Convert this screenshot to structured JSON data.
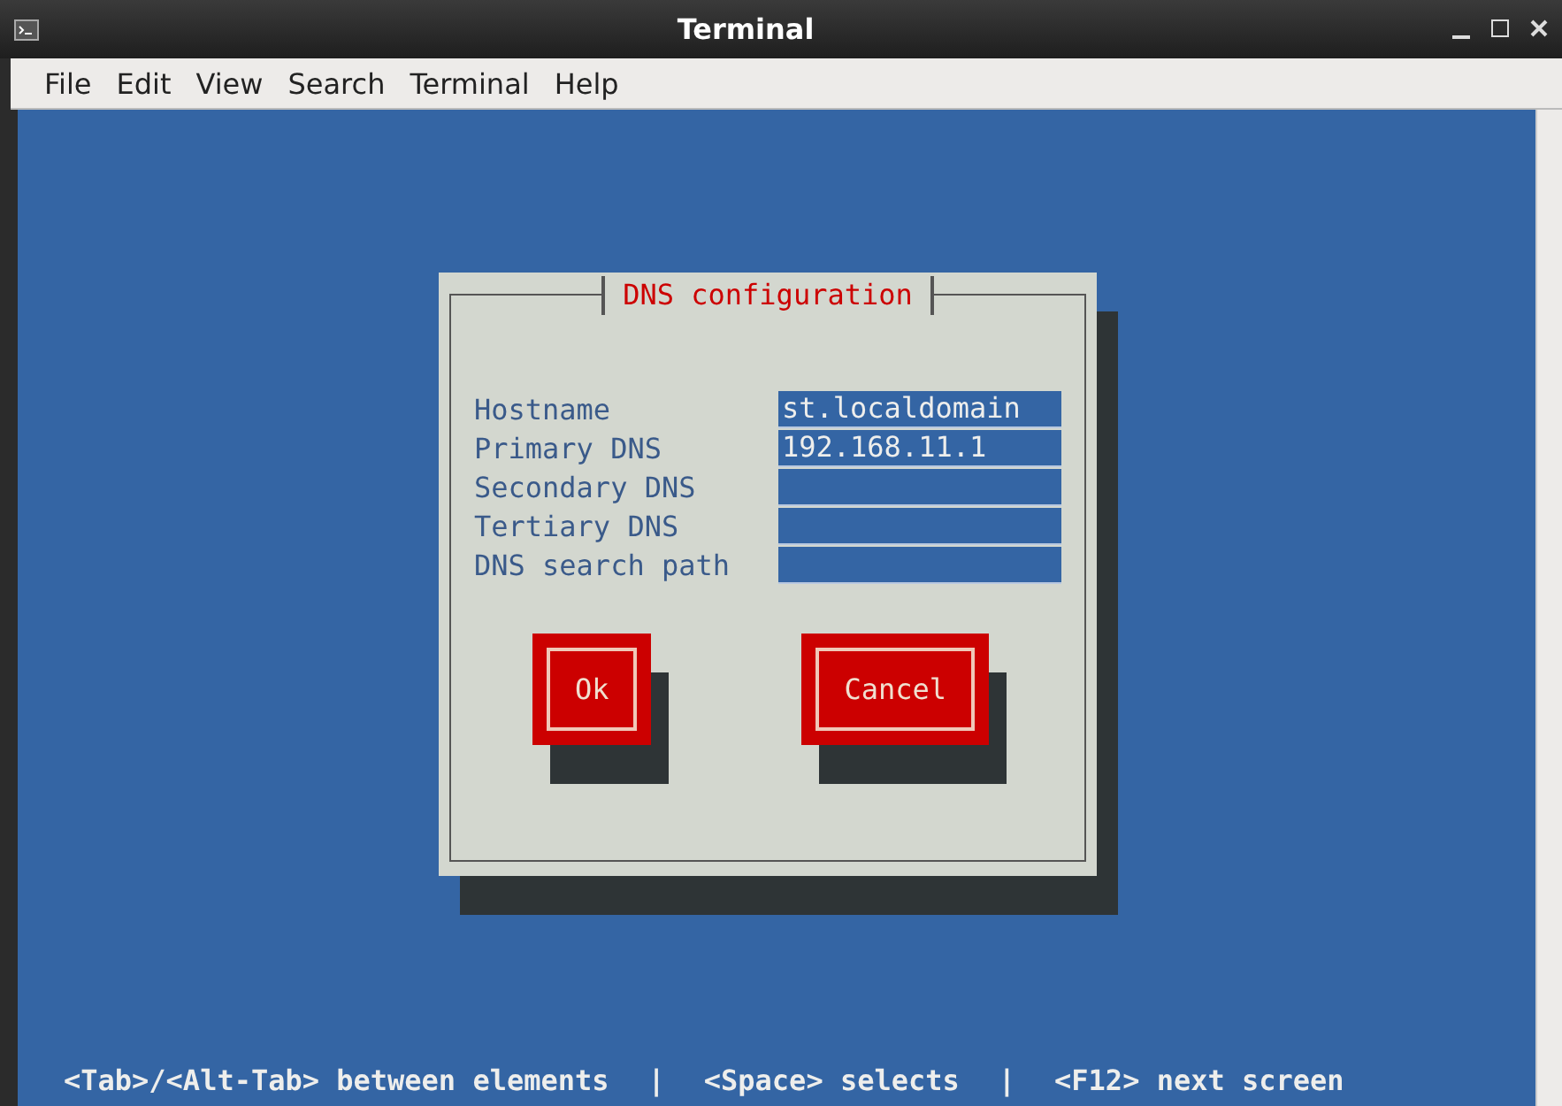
{
  "window": {
    "title": "Terminal"
  },
  "menu": [
    "File",
    "Edit",
    "View",
    "Search",
    "Terminal",
    "Help"
  ],
  "dialog": {
    "title": "DNS configuration",
    "fields": [
      {
        "label": "Hostname",
        "value": "st.localdomain"
      },
      {
        "label": "Primary DNS",
        "value": "192.168.11.1"
      },
      {
        "label": "Secondary DNS"
      },
      {
        "label": "Tertiary DNS"
      },
      {
        "label": "DNS search path"
      }
    ],
    "buttons": [
      "Ok",
      "Cancel"
    ]
  },
  "status_bar": [
    "<Tab>/<Alt-Tab> between elements",
    "|",
    "<Space> selects",
    "|",
    "<F12> next screen"
  ]
}
